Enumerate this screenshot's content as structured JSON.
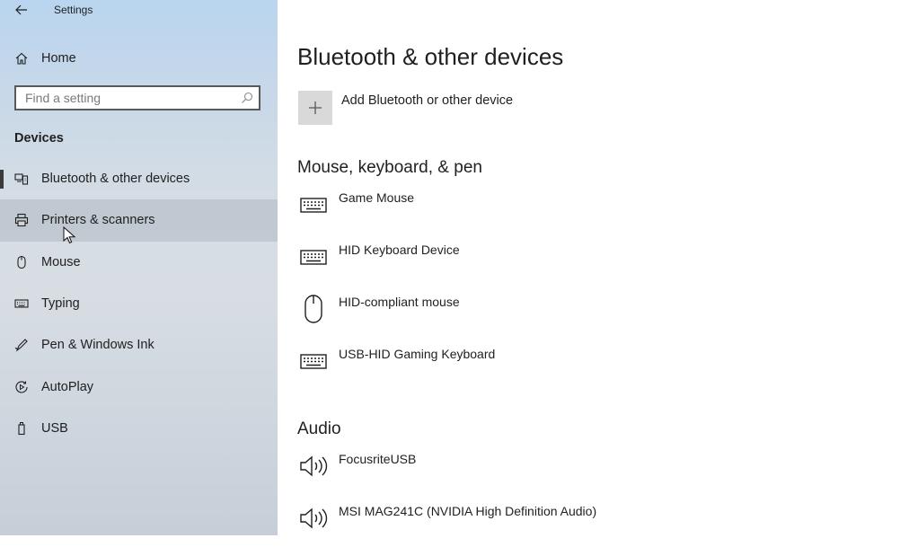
{
  "window": {
    "title": "Settings"
  },
  "sidebar": {
    "home_label": "Home",
    "search_placeholder": "Find a setting",
    "section_label": "Devices",
    "items": [
      {
        "label": "Bluetooth & other devices",
        "icon": "bluetooth-devices-icon",
        "selected": true
      },
      {
        "label": "Printers & scanners",
        "icon": "printer-icon",
        "hover": true
      },
      {
        "label": "Mouse",
        "icon": "mouse-icon"
      },
      {
        "label": "Typing",
        "icon": "keyboard-icon"
      },
      {
        "label": "Pen & Windows Ink",
        "icon": "pen-icon"
      },
      {
        "label": "AutoPlay",
        "icon": "autoplay-icon"
      },
      {
        "label": "USB",
        "icon": "usb-icon"
      }
    ]
  },
  "main": {
    "title": "Bluetooth & other devices",
    "add_device_label": "Add Bluetooth or other device",
    "groups": [
      {
        "title": "Mouse, keyboard, & pen",
        "devices": [
          {
            "name": "Game Mouse",
            "icon": "keyboard-icon"
          },
          {
            "name": "HID Keyboard Device",
            "icon": "keyboard-icon"
          },
          {
            "name": "HID-compliant mouse",
            "icon": "mouse-icon"
          },
          {
            "name": "USB-HID Gaming Keyboard",
            "icon": "keyboard-icon"
          }
        ]
      },
      {
        "title": "Audio",
        "devices": [
          {
            "name": "FocusriteUSB",
            "icon": "speaker-icon"
          },
          {
            "name": "MSI MAG241C (NVIDIA High Definition Audio)",
            "icon": "speaker-icon"
          }
        ]
      }
    ]
  },
  "colors": {
    "text": "#1f1f1f",
    "add_tile": "#d9d9d9",
    "selection_bar": "#3a3a3a"
  }
}
